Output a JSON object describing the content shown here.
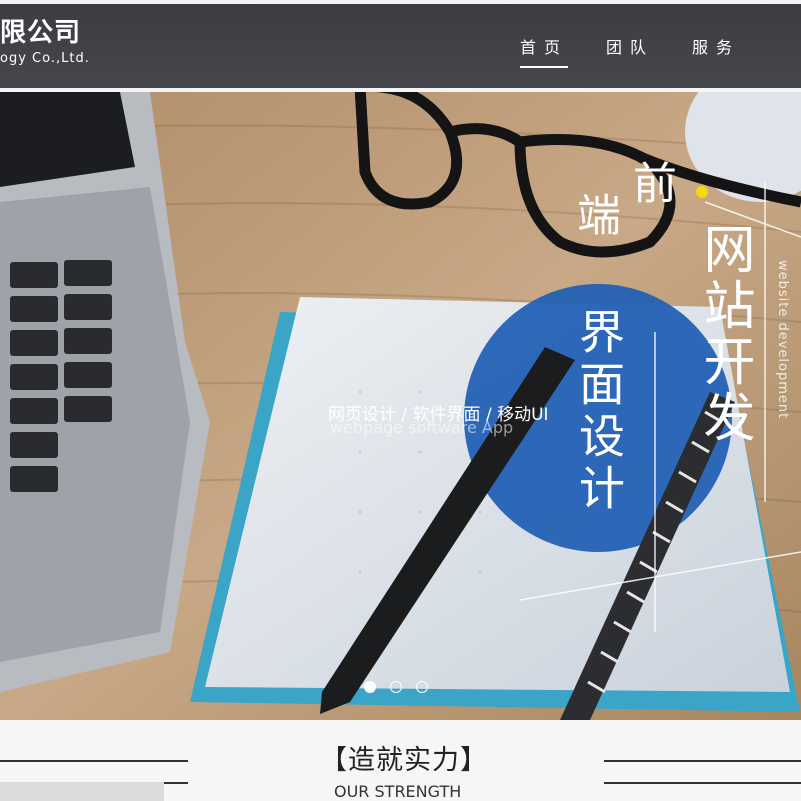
{
  "header": {
    "logo_cn": "限公司",
    "logo_en": "ogy Co.,Ltd."
  },
  "nav": {
    "items": [
      {
        "label": "首页",
        "active": true
      },
      {
        "label": "团队",
        "active": false
      },
      {
        "label": "服务",
        "active": false
      }
    ]
  },
  "banner": {
    "slogan_cn": "网页设计 / 软件界面 / 移动UI",
    "slogan_en": "webpage     software     App",
    "vertical_qian": "前",
    "vertical_duan": "端",
    "vertical_wang": "网站开发",
    "vertical_jiemian": "界面设计",
    "vertical_en": "website development",
    "slides": [
      {
        "active": true
      },
      {
        "active": false
      },
      {
        "active": false
      }
    ],
    "colors": {
      "accent_circle": "#1f5fb4",
      "accent_dot": "#f5d90a"
    }
  },
  "strength": {
    "title": "【造就实力】",
    "subtitle": "OUR STRENGTH"
  }
}
